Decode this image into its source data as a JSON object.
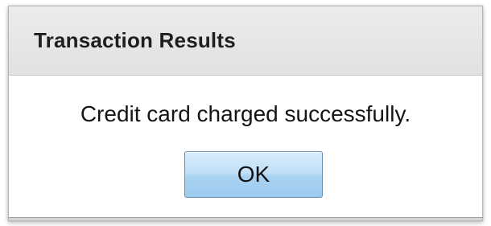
{
  "dialog": {
    "title": "Transaction Results",
    "message": "Credit card charged successfully.",
    "ok_label": "OK"
  },
  "colors": {
    "titlebar_bg": "#e6e6e6",
    "button_bg": "#b5daf4",
    "button_border": "#6a8fb0",
    "text": "#151515"
  }
}
